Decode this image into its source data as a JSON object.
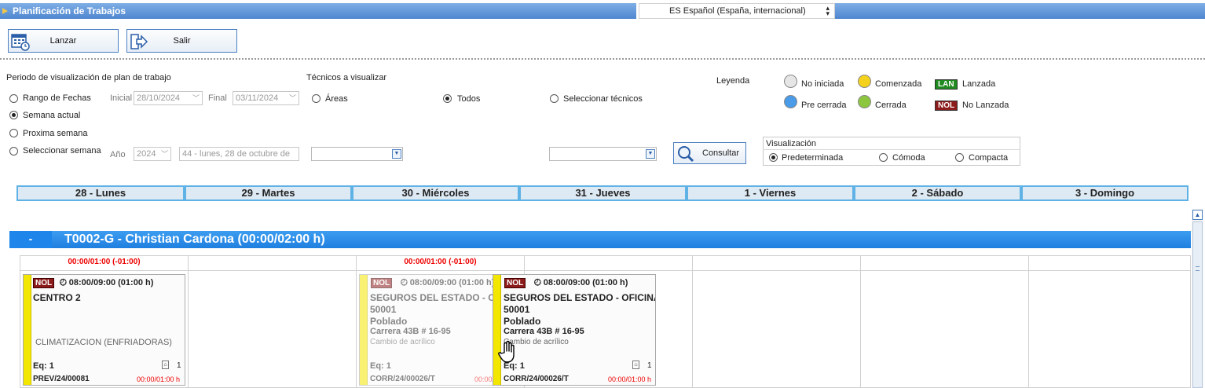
{
  "window": {
    "title": "Planificación de Trabajos",
    "language": "ES Español (España, internacional)"
  },
  "toolbar": {
    "launch_label": "Lanzar",
    "exit_label": "Salir"
  },
  "period": {
    "title": "Periodo de visualización de plan de trabajo",
    "options": [
      "Rango de Fechas",
      "Semana actual",
      "Proxima semana",
      "Seleccionar semana"
    ],
    "selected": "Semana actual",
    "initial_label": "Inicial",
    "initial_value": "28/10/2024",
    "final_label": "Final",
    "final_value": "03/11/2024",
    "year_label": "Año",
    "year_value": "2024",
    "week_value": "44 - lunes, 28 de octubre de"
  },
  "technicians": {
    "title": "Técnicos a visualizar",
    "options": [
      "Áreas",
      "Todos",
      "Seleccionar técnicos"
    ],
    "selected": "Todos"
  },
  "legend": {
    "title": "Leyenda",
    "items": [
      {
        "label": "No iniciada",
        "color": "#e6e6e6"
      },
      {
        "label": "Comenzada",
        "color": "#f4d21c"
      },
      {
        "label": "Pre cerrada",
        "color": "#4a9be8"
      },
      {
        "label": "Cerrada",
        "color": "#8cc63f"
      }
    ],
    "tags": [
      {
        "tag": "LAN",
        "label": "Lanzada",
        "color": "#1f8a1f"
      },
      {
        "tag": "NOL",
        "label": "No Lanzada",
        "color": "#8c1b1b"
      }
    ]
  },
  "consult_label": "Consultar",
  "visualization": {
    "title": "Visualización",
    "options": [
      "Predeterminada",
      "Cómoda",
      "Compacta"
    ],
    "selected": "Predeterminada"
  },
  "days": [
    "28 - Lunes",
    "29 - Martes",
    "30 - Miércoles",
    "31 - Jueves",
    "1 - Viernes",
    "2 - Sábado",
    "3 - Domingo"
  ],
  "technician_row": {
    "collapse": "-",
    "name": "T0002-G - Christian Cardona  (00:00/02:00 h)",
    "day_totals": [
      "00:00/01:00 (-01:00)",
      "",
      "00:00/01:00 (-01:00)",
      "",
      "",
      "",
      ""
    ]
  },
  "cards": [
    {
      "tag": "NOL",
      "time": "08:00/09:00 (01:00 h)",
      "title": "CENTRO 2",
      "line2": "",
      "line3": "",
      "address": "",
      "desc": "CLIMATIZACION (ENFRIADORAS)",
      "eq": "Eq: 1",
      "count": "1",
      "code": "PREV/24/00081",
      "hours": "00:00/01:00 h"
    },
    {
      "tag": "NOL",
      "time": "08:00/09:00 (01:00 h)",
      "title": "SEGUROS DEL ESTADO - O",
      "line2": "50001",
      "line3": "Poblado",
      "address": "Carrera 43B # 16-95",
      "desc": "Cambio de acrílico",
      "eq": "Eq: 1",
      "count": "",
      "code": "CORR/24/00026/T",
      "hours": "00:00/"
    },
    {
      "tag": "NOL",
      "time": "08:00/09:00 (01:00 h)",
      "title": "SEGUROS DEL ESTADO - OFICINA",
      "line2": "50001",
      "line3": "Poblado",
      "address": "Carrera 43B # 16-95",
      "desc": "Cambio de acrílico",
      "eq": "Eq: 1",
      "count": "1",
      "code": "CORR/24/00026/T",
      "hours": "00:00/01:00 h"
    }
  ]
}
